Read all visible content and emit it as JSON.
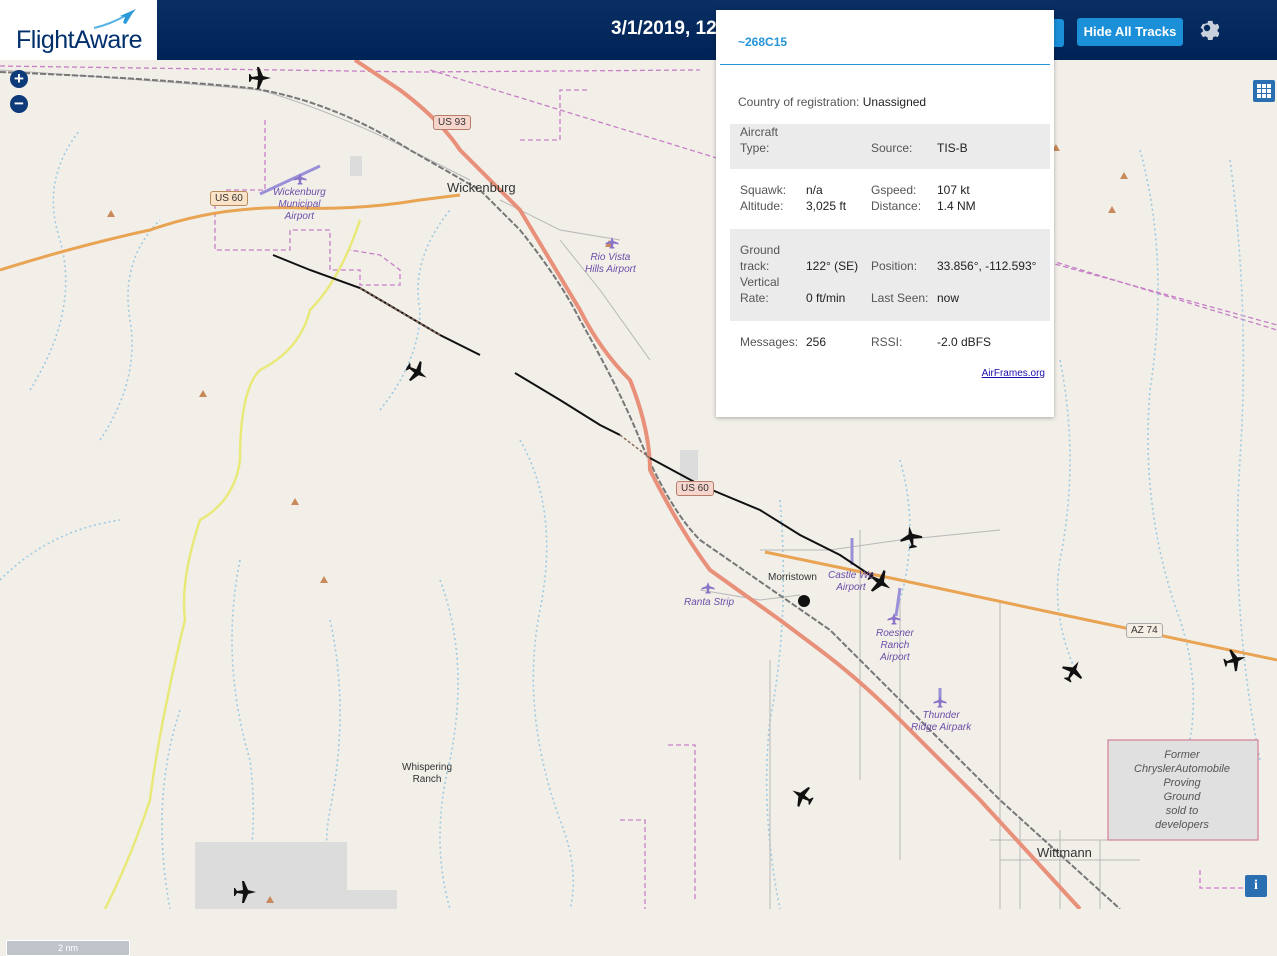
{
  "header": {
    "logo_text": "FlightAware",
    "date_text": "3/1/2019, 12",
    "buttons": {
      "hide_tracks": "Hide All Tracks"
    },
    "colors": {
      "bar": "#002357",
      "button": "#1b8fd8"
    }
  },
  "map": {
    "zoom_in": "+",
    "zoom_out": "−",
    "scale_label": "2 nm",
    "info_label": "i",
    "places": {
      "wickenburg": "Wickenburg",
      "morristown": "Morristown",
      "wittmann": "Wittmann",
      "whispering": "Whispering\nRanch",
      "former": "Former\nChryslerAutomobile\nProving\nGround\nsold to\ndevelopers"
    },
    "airports": {
      "wickenburg": "Wickenburg\nMunicipal\nAirport",
      "rio_vista": "Rio Vista\nHills Airport",
      "castle": "Castle We\nAirport",
      "ranta": "Ranta Strip",
      "roesner": "Roesner\nRanch\nAirport",
      "thunder": "Thunder\nRidge Airpark"
    },
    "shields": {
      "us93": "US 93",
      "us60_west": "US 60",
      "us60_mid": "US 60",
      "az74": "AZ 74"
    }
  },
  "popup": {
    "id": "~268C15",
    "country_label": "Country of registration:",
    "country_value": "Unassigned",
    "aircraft_type_label": "Aircraft\nType:",
    "aircraft_type_value": "",
    "source_label": "Source:",
    "source_value": "TIS-B",
    "squawk_label": "Squawk:",
    "squawk_value": "n/a",
    "altitude_label": "Altitude:",
    "altitude_value": "3,025 ft",
    "gspeed_label": "Gspeed:",
    "gspeed_value": "107 kt",
    "distance_label": "Distance:",
    "distance_value": "1.4 NM",
    "ground_track_label": "Ground\ntrack:",
    "ground_track_value": "122° (SE)",
    "vertical_rate_label": "Vertical\nRate:",
    "vertical_rate_value": "0 ft/min",
    "position_label": "Position:",
    "position_value": "33.856°, -112.593°",
    "last_seen_label": "Last Seen:",
    "last_seen_value": "now",
    "messages_label": "Messages:",
    "messages_value": "256",
    "rssi_label": "RSSI:",
    "rssi_value": "-2.0 dBFS",
    "airframes_link": "AirFrames.org"
  }
}
